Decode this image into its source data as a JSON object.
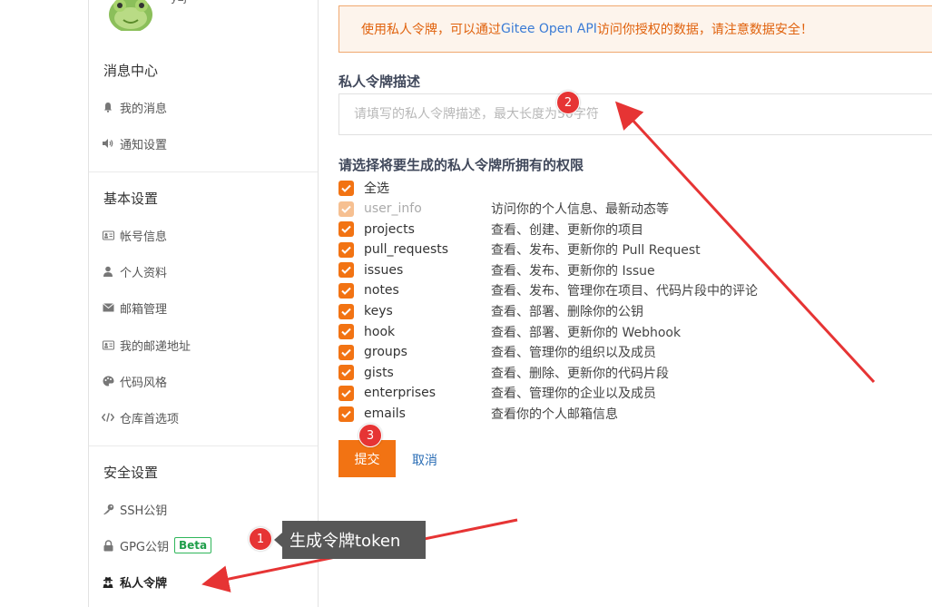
{
  "sidebar": {
    "username": "yzj",
    "groups": [
      {
        "title": "消息中心",
        "items": [
          {
            "label": "我的消息",
            "icon": "bell-icon"
          },
          {
            "label": "通知设置",
            "icon": "volume-icon"
          }
        ]
      },
      {
        "title": "基本设置",
        "items": [
          {
            "label": "帐号信息",
            "icon": "id-card-icon"
          },
          {
            "label": "个人资料",
            "icon": "user-icon"
          },
          {
            "label": "邮箱管理",
            "icon": "envelope-icon"
          },
          {
            "label": "我的邮递地址",
            "icon": "address-card-icon"
          },
          {
            "label": "代码风格",
            "icon": "palette-icon"
          },
          {
            "label": "仓库首选项",
            "icon": "code-icon"
          }
        ]
      },
      {
        "title": "安全设置",
        "items": [
          {
            "label": "SSH公钥",
            "icon": "key-icon"
          },
          {
            "label": "GPG公钥",
            "icon": "lock-icon",
            "badge": "Beta"
          },
          {
            "label": "私人令牌",
            "icon": "user-secret-icon",
            "active": true
          }
        ]
      }
    ]
  },
  "main": {
    "alert_text_before": "使用私人令牌，可以通过 ",
    "alert_link": "Gitee Open API",
    "alert_text_after": " 访问你授权的数据，请注意数据安全！",
    "description_label": "私人令牌描述",
    "description_placeholder": "请填写的私人令牌描述，最大长度为50字符",
    "permissions_label": "请选择将要生成的私人令牌所拥有的权限",
    "select_all": "全选",
    "permissions": [
      {
        "name": "user_info",
        "desc": "访问你的个人信息、最新动态等",
        "disabled": true
      },
      {
        "name": "projects",
        "desc": "查看、创建、更新你的项目"
      },
      {
        "name": "pull_requests",
        "desc": "查看、发布、更新你的 Pull Request"
      },
      {
        "name": "issues",
        "desc": "查看、发布、更新你的 Issue"
      },
      {
        "name": "notes",
        "desc": "查看、发布、管理你在项目、代码片段中的评论"
      },
      {
        "name": "keys",
        "desc": "查看、部署、删除你的公钥"
      },
      {
        "name": "hook",
        "desc": "查看、部署、更新你的 Webhook"
      },
      {
        "name": "groups",
        "desc": "查看、管理你的组织以及成员"
      },
      {
        "name": "gists",
        "desc": "查看、删除、更新你的代码片段"
      },
      {
        "name": "enterprises",
        "desc": "查看、管理你的企业以及成员"
      },
      {
        "name": "emails",
        "desc": "查看你的个人邮箱信息"
      }
    ],
    "submit_label": "提交",
    "cancel_label": "取消"
  },
  "annotations": {
    "badge_1": "1",
    "badge_2": "2",
    "badge_3": "3",
    "tooltip": "生成令牌token"
  },
  "colors": {
    "accent": "#f27313",
    "alert_bg": "#fdf4ec",
    "alert_border": "#f0a86f",
    "annotation_red": "#e63434",
    "beta_green": "#1f9e4a"
  }
}
